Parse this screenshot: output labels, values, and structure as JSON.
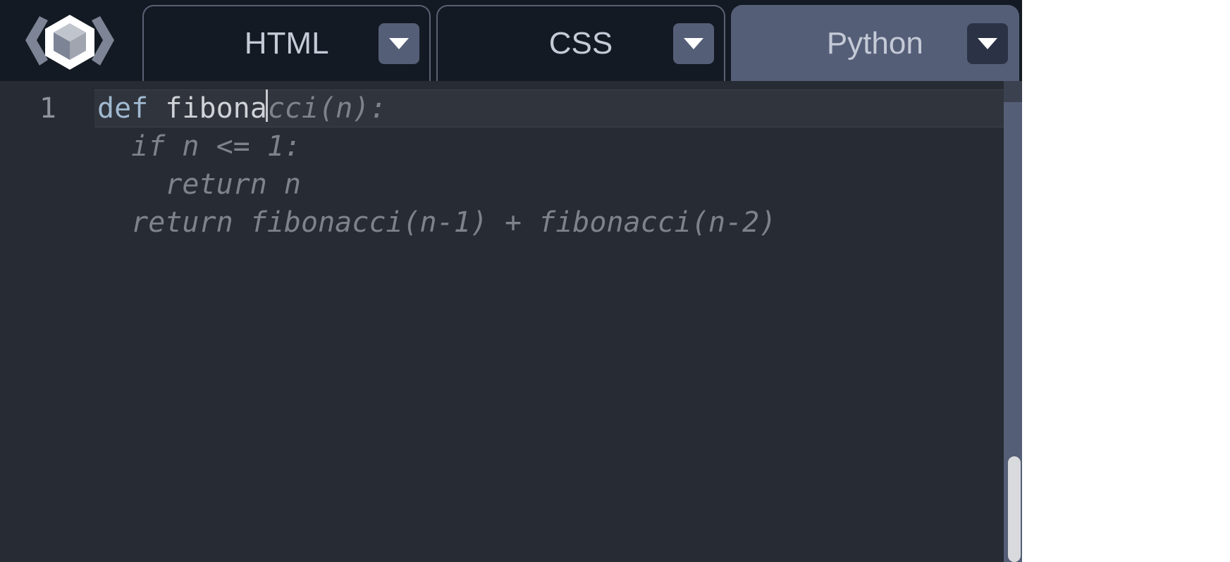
{
  "tabs": [
    {
      "label": "HTML",
      "active": false
    },
    {
      "label": "CSS",
      "active": false
    },
    {
      "label": "Python",
      "active": true
    }
  ],
  "editor": {
    "line_number": "1",
    "typed_keyword": "def",
    "typed_rest": " fibona",
    "ghost_inline": "cci(n):",
    "ghost_lines": [
      "  if n <= 1:",
      "    return n",
      "  return fibonacci(n-1) + fibonacci(n-2)"
    ]
  }
}
